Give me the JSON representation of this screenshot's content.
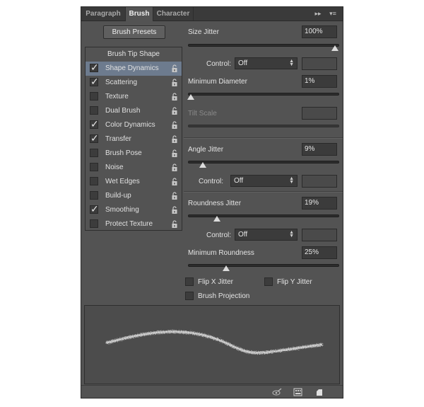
{
  "tabs": [
    "Paragraph",
    "Brush",
    "Character"
  ],
  "active_tab": "Brush",
  "presets_button": "Brush Presets",
  "list": {
    "header": "Brush Tip Shape",
    "items": [
      {
        "label": "Shape Dynamics",
        "checked": true,
        "selected": true
      },
      {
        "label": "Scattering",
        "checked": true
      },
      {
        "label": "Texture",
        "checked": false
      },
      {
        "label": "Dual Brush",
        "checked": false
      },
      {
        "label": "Color Dynamics",
        "checked": true
      },
      {
        "label": "Transfer",
        "checked": true
      },
      {
        "label": "Brush Pose",
        "checked": false
      },
      {
        "label": "Noise",
        "checked": false
      },
      {
        "label": "Wet Edges",
        "checked": false
      },
      {
        "label": "Build-up",
        "checked": false
      },
      {
        "label": "Smoothing",
        "checked": true
      },
      {
        "label": "Protect Texture",
        "checked": false
      }
    ]
  },
  "settings": {
    "size_jitter": {
      "label": "Size Jitter",
      "value": "100%",
      "level": 1.0
    },
    "control1": {
      "label": "Control:",
      "value": "Off"
    },
    "min_diameter": {
      "label": "Minimum Diameter",
      "value": "1%",
      "level": 0.01
    },
    "tilt_scale": {
      "label": "Tilt Scale",
      "value": ""
    },
    "angle_jitter": {
      "label": "Angle Jitter",
      "value": "9%",
      "level": 0.09
    },
    "control2": {
      "label": "Control:",
      "value": "Off"
    },
    "roundness_jitter": {
      "label": "Roundness Jitter",
      "value": "19%",
      "level": 0.19
    },
    "control3": {
      "label": "Control:",
      "value": "Off"
    },
    "min_roundness": {
      "label": "Minimum Roundness",
      "value": "25%",
      "level": 0.25
    },
    "flip_x": {
      "label": "Flip X Jitter",
      "checked": false
    },
    "flip_y": {
      "label": "Flip Y Jitter",
      "checked": false
    },
    "brush_projection": {
      "label": "Brush Projection",
      "checked": false
    }
  },
  "icons": {
    "collapse": "double-arrow-icon",
    "menu": "panel-menu-icon",
    "toggle_preview": "eye-brush-icon",
    "grid": "grid-icon",
    "new_brush": "new-brush-icon"
  },
  "colors": {
    "panel": "#535353",
    "selection": "#6d7b8e",
    "tabbar": "#3a3a3a"
  }
}
